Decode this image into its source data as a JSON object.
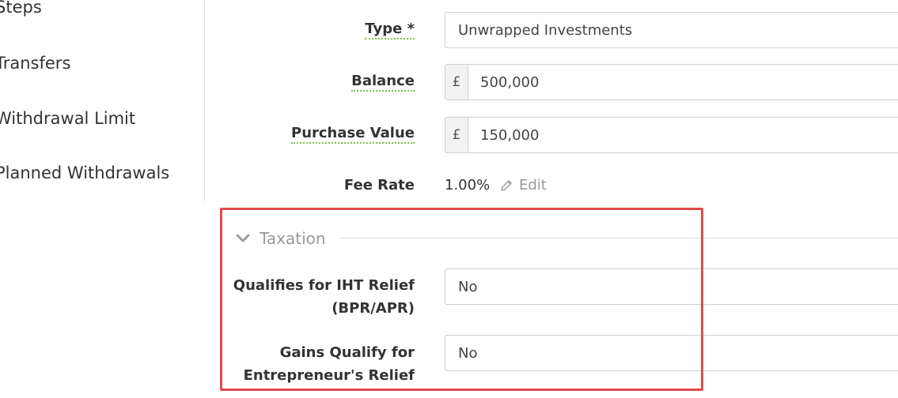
{
  "sidebar": {
    "items": [
      {
        "label": "Steps"
      },
      {
        "label": "Transfers"
      },
      {
        "label": "Withdrawal Limit"
      },
      {
        "label": "Planned Withdrawals"
      }
    ]
  },
  "form": {
    "type": {
      "label": "Type *",
      "value": "Unwrapped Investments"
    },
    "balance": {
      "label": "Balance",
      "currency": "£",
      "value": "500,000"
    },
    "purchase_value": {
      "label": "Purchase Value",
      "currency": "£",
      "value": "150,000"
    },
    "fee_rate": {
      "label": "Fee Rate",
      "value": "1.00%",
      "edit_label": "Edit"
    }
  },
  "taxation": {
    "title": "Taxation",
    "iht_relief": {
      "label_line1": "Qualifies for IHT Relief",
      "label_line2": "(BPR/APR)",
      "value": "No"
    },
    "entrepreneurs_relief": {
      "label_line1": "Gains Qualify for",
      "label_line2": "Entrepreneur's Relief",
      "value": "No"
    }
  },
  "colors": {
    "highlight_border": "#e04a4a",
    "help_underline": "#7cc242",
    "muted_text": "#999999"
  }
}
